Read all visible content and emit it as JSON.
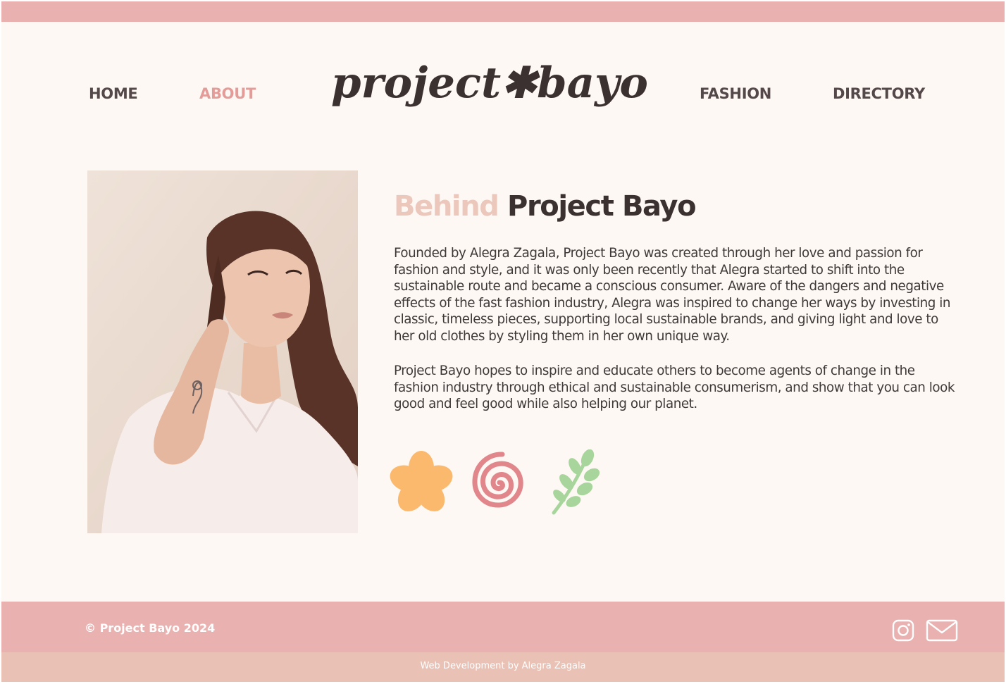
{
  "nav": {
    "home": "HOME",
    "about": "ABOUT",
    "fashion": "FASHION",
    "directory": "DIRECTORY",
    "active": "about"
  },
  "logo": {
    "text": "project✱bayo"
  },
  "about": {
    "heading_accent": "Behind",
    "heading_main": "Project Bayo",
    "paragraph_1": "Founded by Alegra Zagala, Project Bayo was created through her love and passion for fashion and style, and it was only been recently that Alegra started to shift into the sustainable route and became a conscious consumer. Aware of the dangers and negative effects of the fast fashion industry, Alegra was inspired to change her ways by investing in classic, timeless pieces, supporting local sustainable brands, and giving light and love to her old clothes by styling them in her own unique way.",
    "paragraph_2": "Project Bayo hopes to inspire and educate others to become agents of change in the fashion industry through ethical and sustainable consumerism, and show that you can look good and feel good while also helping our planet.",
    "photo_alt": "Alegra Zagala"
  },
  "decorations": [
    "flower-icon",
    "spiral-icon",
    "leaf-icon"
  ],
  "footer": {
    "copyright": "© Project Bayo 2024",
    "credit": "Web Development by Alegra Zagala",
    "icons": [
      "instagram-icon",
      "mail-icon"
    ]
  },
  "colors": {
    "bar": "#e9b1b0",
    "subfooter": "#e9c1b5",
    "background": "#fdf8f4",
    "accent": "#e39c98",
    "heading_accent": "#ecc7bc",
    "text_dark": "#3a3130",
    "flower": "#fbb96e",
    "spiral": "#e1868a",
    "leaf": "#a8d59b"
  }
}
